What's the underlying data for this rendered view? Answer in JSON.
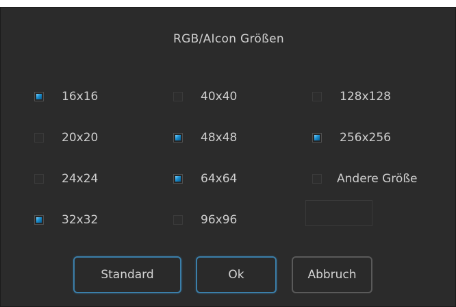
{
  "dialog": {
    "title": "RGB/AIcon Größen"
  },
  "sizes": [
    {
      "label": "16x16",
      "checked": true
    },
    {
      "label": "20x20",
      "checked": false
    },
    {
      "label": "24x24",
      "checked": false
    },
    {
      "label": "32x32",
      "checked": true
    },
    {
      "label": "40x40",
      "checked": false
    },
    {
      "label": "48x48",
      "checked": true
    },
    {
      "label": "64x64",
      "checked": true
    },
    {
      "label": "96x96",
      "checked": false
    },
    {
      "label": "128x128",
      "checked": false
    },
    {
      "label": "256x256",
      "checked": true
    },
    {
      "label": "Andere Größe",
      "checked": false
    }
  ],
  "custom_size": {
    "value": ""
  },
  "buttons": {
    "standard": "Standard",
    "ok": "Ok",
    "cancel": "Abbruch"
  },
  "colors": {
    "accent": "#3b7faa",
    "background": "#2b2b2b",
    "check": "#1a8fd0"
  }
}
